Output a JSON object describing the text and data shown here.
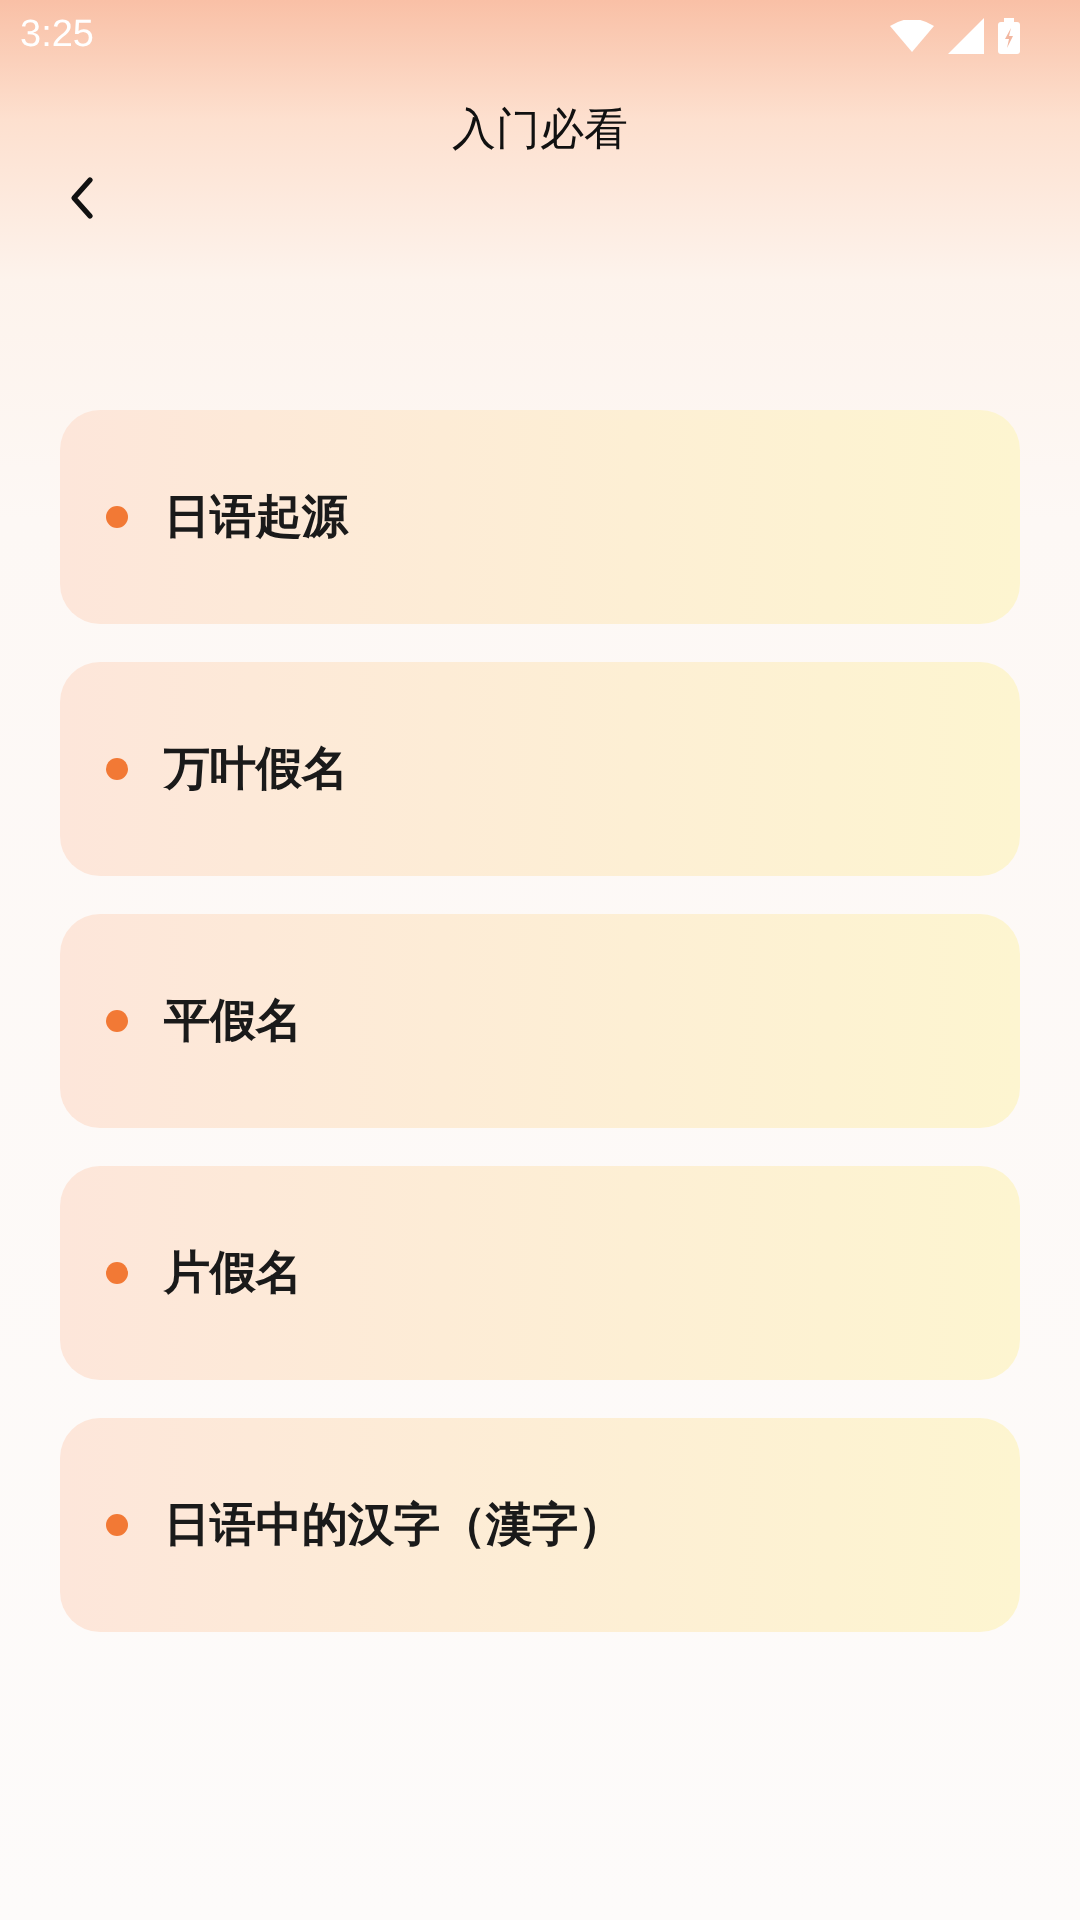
{
  "status_bar": {
    "time": "3:25"
  },
  "header": {
    "title": "入门必看"
  },
  "items": [
    {
      "title": "日语起源"
    },
    {
      "title": "万叶假名"
    },
    {
      "title": "平假名"
    },
    {
      "title": "片假名"
    },
    {
      "title": "日语中的汉字（漢字）"
    }
  ]
}
